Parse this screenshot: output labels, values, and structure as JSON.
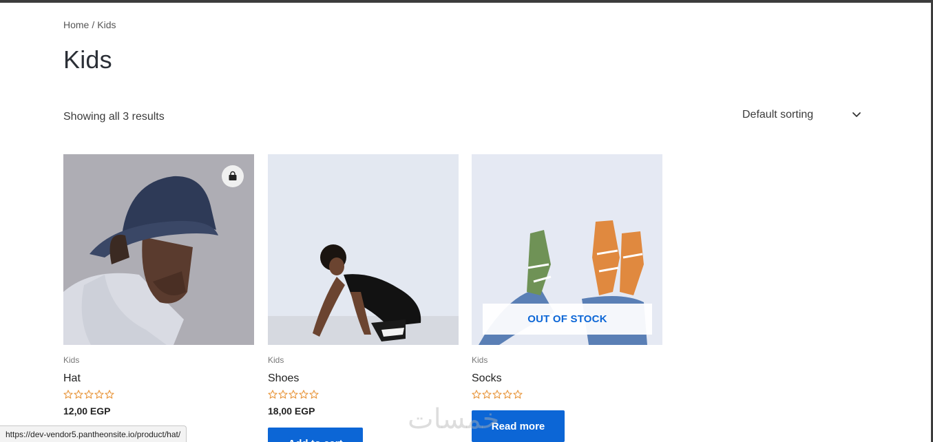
{
  "breadcrumb": {
    "home": "Home",
    "separator": "/",
    "current": "Kids"
  },
  "page_title": "Kids",
  "result_count": "Showing all 3 results",
  "sorting": {
    "selected": "Default sorting",
    "icon": "chevron-down-icon"
  },
  "products": [
    {
      "category": "Kids",
      "name": "Hat",
      "rating": 0,
      "price": "12,00 EGP",
      "badge_icon": "shopping-bag-icon"
    },
    {
      "category": "Kids",
      "name": "Shoes",
      "rating": 0,
      "price": "18,00 EGP",
      "button": "Add to cart"
    },
    {
      "category": "Kids",
      "name": "Socks",
      "rating": 0,
      "overlay": "OUT OF STOCK",
      "button": "Read more"
    }
  ],
  "status_bar": {
    "url": "https://dev-vendor5.pantheonsite.io/product/hat/"
  },
  "watermark": "خمسات",
  "colors": {
    "accent": "#0c66d6",
    "star": "#e8953a",
    "text": "#3a3a3a"
  }
}
